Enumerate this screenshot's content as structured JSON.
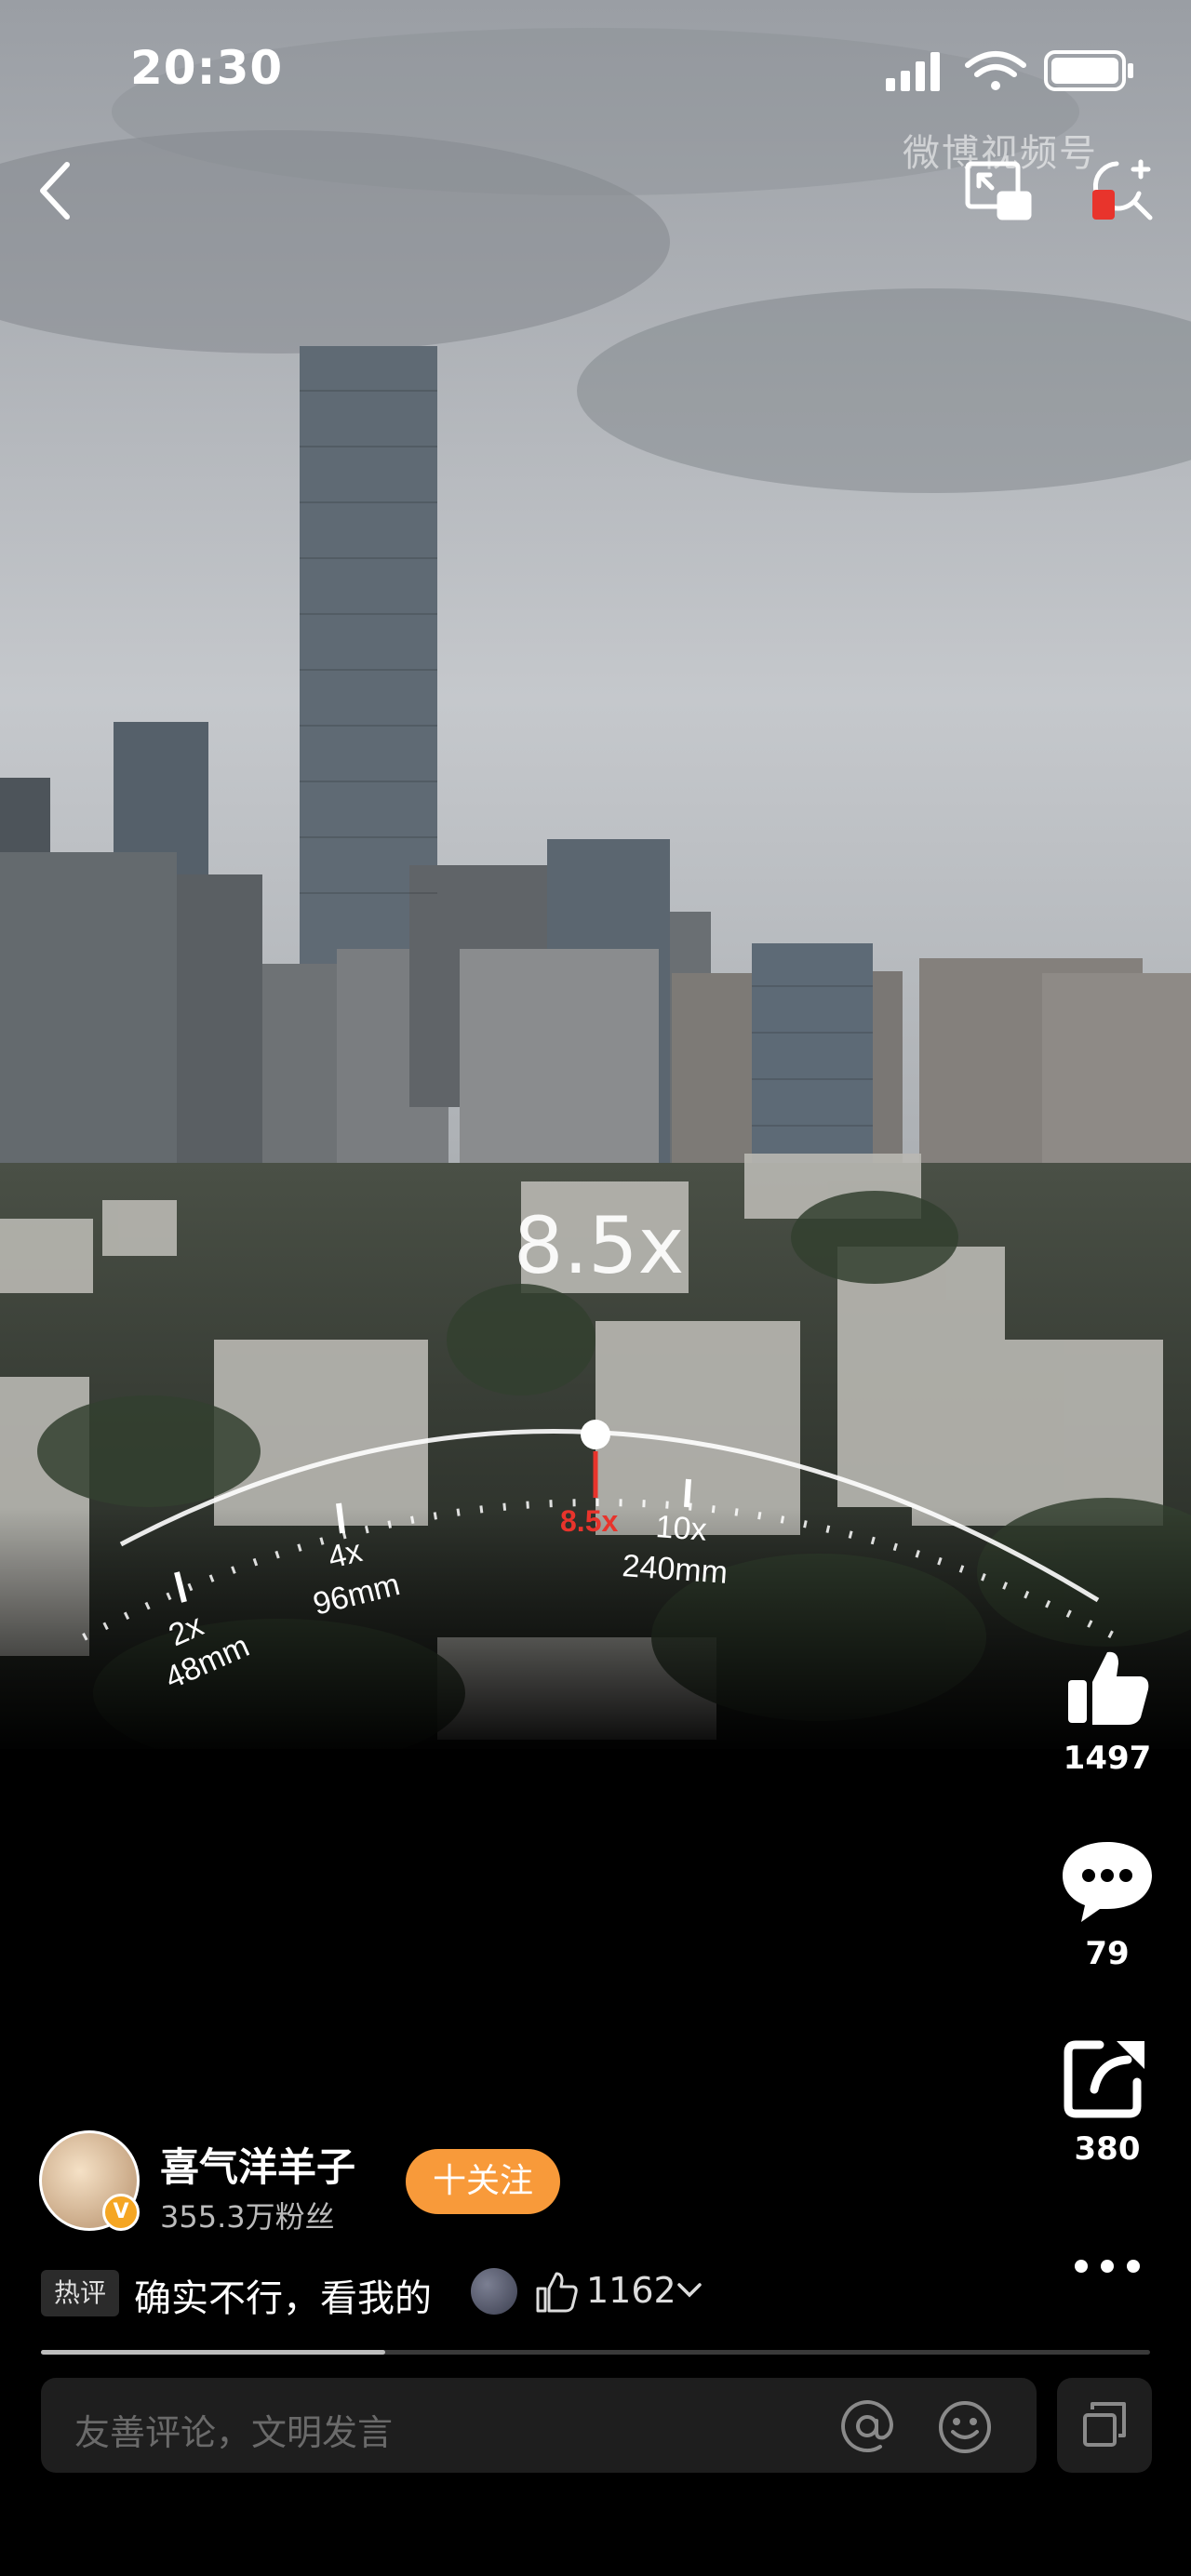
{
  "status_bar": {
    "time": "20:30"
  },
  "header": {
    "watermark": "微博视频号"
  },
  "video": {
    "zoom_label": "8.5x",
    "current_zoom": "8.5x",
    "dial": {
      "ticks": [
        {
          "zoom": "2x",
          "focal": "48mm"
        },
        {
          "zoom": "4x",
          "focal": "96mm"
        },
        {
          "zoom": "10x",
          "focal": "240mm"
        }
      ]
    }
  },
  "actions": {
    "like_count": "1497",
    "comment_count": "79",
    "share_count": "380"
  },
  "author": {
    "name": "喜气洋羊子",
    "fans": "355.3万粉丝",
    "follow_label": "十关注",
    "verified_badge": "V"
  },
  "hot_comment": {
    "tag": "热评",
    "text": "确实不行，看我的",
    "like_count": "1162"
  },
  "progress": {
    "fraction": 0.31
  },
  "comment_bar": {
    "placeholder": "友善评论，文明发言"
  },
  "colors": {
    "accent": "#f89a3a",
    "zoom_red": "#e8342c"
  }
}
